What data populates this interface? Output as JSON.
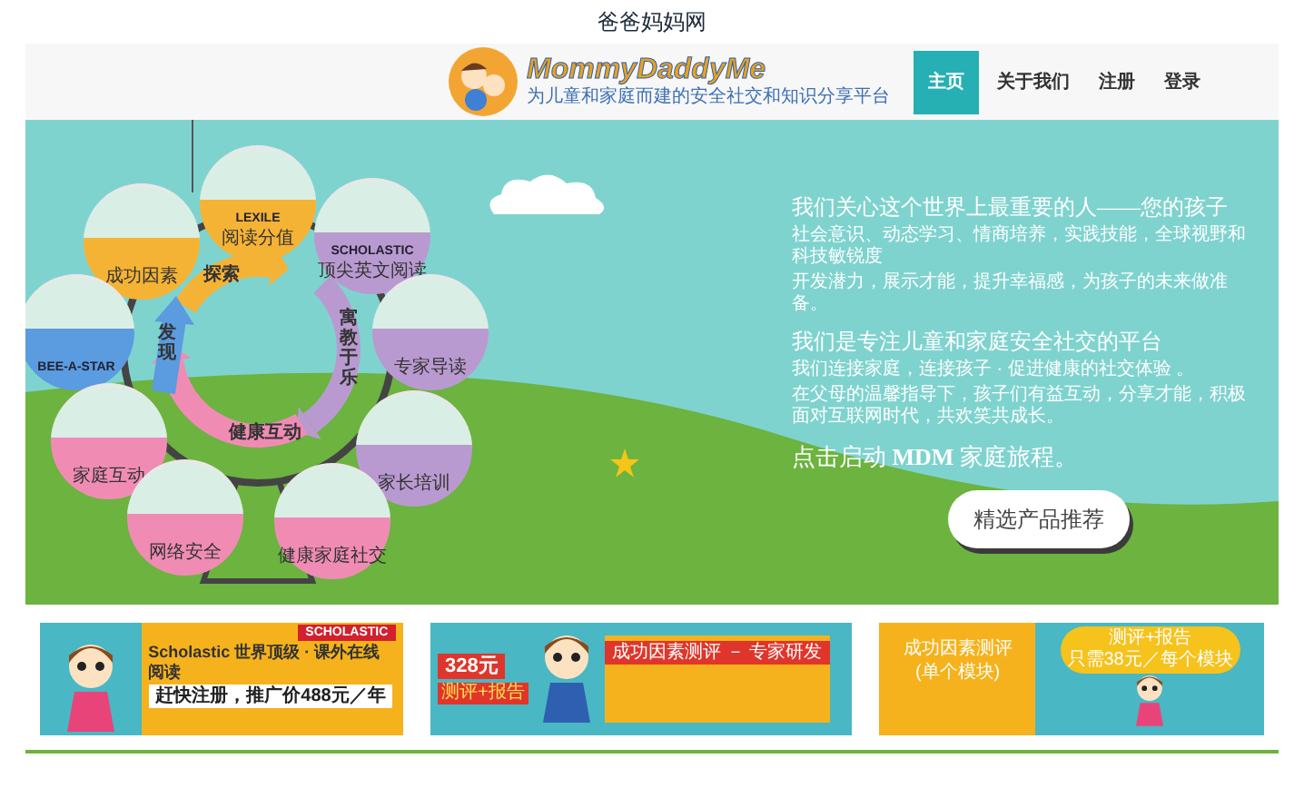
{
  "page_title": "爸爸妈妈网",
  "header": {
    "logo": {
      "brand": "MommyDaddyMe",
      "tagline": "为儿童和家庭而建的安全社交和知识分享平台"
    },
    "nav": [
      {
        "label": "主页",
        "selected": true
      },
      {
        "label": "关于我们",
        "selected": false
      },
      {
        "label": "注册",
        "selected": false
      },
      {
        "label": "登录",
        "selected": false
      }
    ]
  },
  "hero": {
    "wheel": {
      "gondolas": [
        {
          "lines": [
            "LEXILE",
            "阅读分值"
          ],
          "color": "#f5b335"
        },
        {
          "lines": [
            "成功因素"
          ],
          "color": "#f5b335"
        },
        {
          "lines": [
            "SCHOLASTIC",
            "顶尖英文阅读"
          ],
          "color": "#b99ad0"
        },
        {
          "lines": [
            "BEE-A-STAR"
          ],
          "color": "#5b9be0"
        },
        {
          "lines": [
            "专家导读"
          ],
          "color": "#b99ad0"
        },
        {
          "lines": [
            "家庭互动"
          ],
          "color": "#f08cb4"
        },
        {
          "lines": [
            "家长培训"
          ],
          "color": "#b99ad0"
        },
        {
          "lines": [
            "网络安全"
          ],
          "color": "#f08cb4"
        },
        {
          "lines": [
            "健康家庭社交"
          ],
          "color": "#f08cb4"
        }
      ],
      "arrows": [
        {
          "label": "探索",
          "color": "#f5b335"
        },
        {
          "label": "寓教于乐",
          "color": "#b99ad0"
        },
        {
          "label": "健康互动",
          "color": "#f08cb4"
        },
        {
          "label": "发现",
          "color": "#5b9be0"
        }
      ]
    },
    "sections": [
      {
        "heading": "我们关心这个世界上最重要的人——您的孩子",
        "paragraphs": [
          "社会意识、动态学习、情商培养，实践技能，全球视野和科技敏锐度",
          "开发潜力，展示才能，提升幸福感，为孩子的未来做准备。"
        ]
      },
      {
        "heading": "我们是专注儿童和家庭安全社交的平台",
        "paragraphs": [
          "我们连接家庭，连接孩子 · 促进健康的社交体验 。",
          "在父母的温馨指导下，孩子们有益互动，分享才能，积极面对互联网时代，共欢笑共成长。"
        ]
      }
    ],
    "call_to_action": "点击启动 **MDM** 家庭旅程。",
    "button": "精选产品推荐"
  },
  "banners": [
    {
      "kind": "scholastic",
      "badge": "SCHOLASTIC",
      "title": "Scholastic 世界顶级 · 课外在线阅读",
      "offer": "赶快注册，推广价488元／年"
    },
    {
      "kind": "assessment",
      "price": "328元",
      "tag": "测评+报告",
      "title": "成功因素测评 － 专家研发"
    },
    {
      "kind": "module",
      "title": "成功因素测评",
      "subtitle": "(单个模块)",
      "bubble_top": "测评+报告",
      "bubble_bottom": "只需38元／每个模块"
    }
  ]
}
